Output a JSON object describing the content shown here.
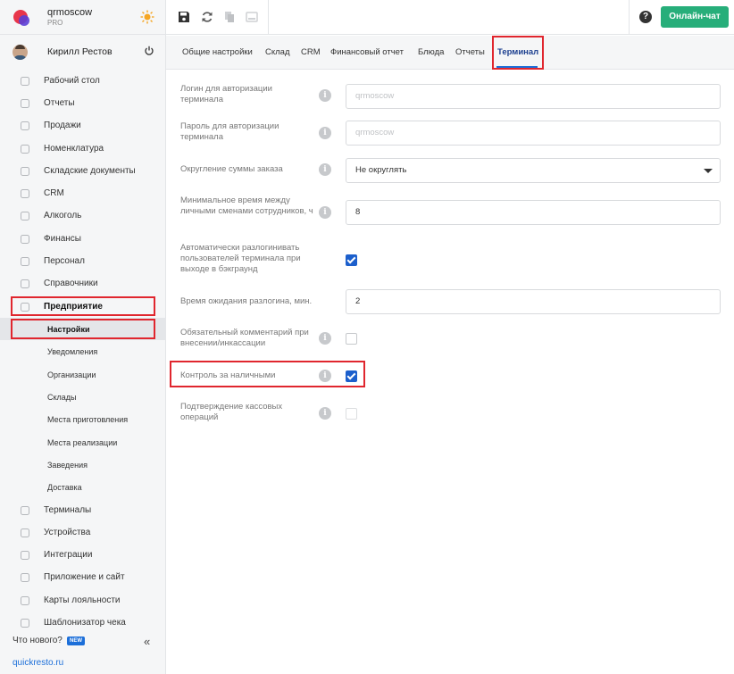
{
  "brand": {
    "name": "qrmoscow",
    "tier": "PRO"
  },
  "user": {
    "name": "Кирилл Рестов"
  },
  "sidebar": {
    "items": [
      {
        "label": "Рабочий стол",
        "icon": "dashboard-icon"
      },
      {
        "label": "Отчеты",
        "icon": "chart-icon"
      },
      {
        "label": "Продажи",
        "icon": "basket-icon"
      },
      {
        "label": "Номенклатура",
        "icon": "tag-icon"
      },
      {
        "label": "Складские документы",
        "icon": "box-icon"
      },
      {
        "label": "CRM",
        "icon": "people-icon"
      },
      {
        "label": "Алкоголь",
        "icon": "glass-icon"
      },
      {
        "label": "Финансы",
        "icon": "wallet-icon"
      },
      {
        "label": "Персонал",
        "icon": "staff-icon"
      },
      {
        "label": "Справочники",
        "icon": "book-icon"
      },
      {
        "label": "Предприятие",
        "icon": "store-icon"
      }
    ],
    "sub_items": [
      {
        "label": "Настройки"
      },
      {
        "label": "Уведомления"
      },
      {
        "label": "Организации"
      },
      {
        "label": "Склады"
      },
      {
        "label": "Места приготовления"
      },
      {
        "label": "Места реализации"
      },
      {
        "label": "Заведения"
      },
      {
        "label": "Доставка"
      }
    ],
    "items_after": [
      {
        "label": "Терминалы",
        "icon": "terminal-icon"
      },
      {
        "label": "Устройства",
        "icon": "printer-icon"
      },
      {
        "label": "Интеграции",
        "icon": "link-icon"
      },
      {
        "label": "Приложение и сайт",
        "icon": "monitor-icon"
      },
      {
        "label": "Карты лояльности",
        "icon": "card-icon"
      },
      {
        "label": "Шаблонизатор чека",
        "icon": "receipt-icon"
      }
    ],
    "whats_new": "Что нового?",
    "new_badge": "NEW",
    "collapse": "«",
    "footer_link": "quickresto.ru"
  },
  "topbar": {
    "chat_button": "Онлайн-чат",
    "help": "?"
  },
  "tabs": [
    {
      "label": "Общие настройки"
    },
    {
      "label": "Склад"
    },
    {
      "label": "CRM"
    },
    {
      "label": "Финансовый отчет"
    },
    {
      "label": "Блюда"
    },
    {
      "label": "Отчеты"
    },
    {
      "label": "Терминал",
      "active": true
    }
  ],
  "form": {
    "login_label": "Логин для авторизации терминала",
    "login_placeholder": "qrmoscow",
    "password_label": "Пароль для авторизации терминала",
    "password_placeholder": "qrmoscow",
    "rounding_label": "Округление суммы заказа",
    "rounding_value": "Не округлять",
    "min_time_label": "Минимальное время между личными сменами сотрудников, ч",
    "min_time_value": "8",
    "auto_logout_label": "Автоматически разлогинивать пользователей терминала при выходе в бэкграунд",
    "auto_logout_checked": true,
    "logout_wait_label": "Время ожидания разлогина, мин.",
    "logout_wait_value": "2",
    "comment_label": "Обязательный комментарий при внесении/инкассации",
    "comment_checked": false,
    "cash_control_label": "Контроль за наличными",
    "cash_control_checked": true,
    "confirm_label": "Подтверждение кассовых операций",
    "confirm_checked": false,
    "info_glyph": "i"
  },
  "colors": {
    "accent": "#1c5fcc",
    "chat": "#27ae7a",
    "highlight": "#e0262e"
  }
}
